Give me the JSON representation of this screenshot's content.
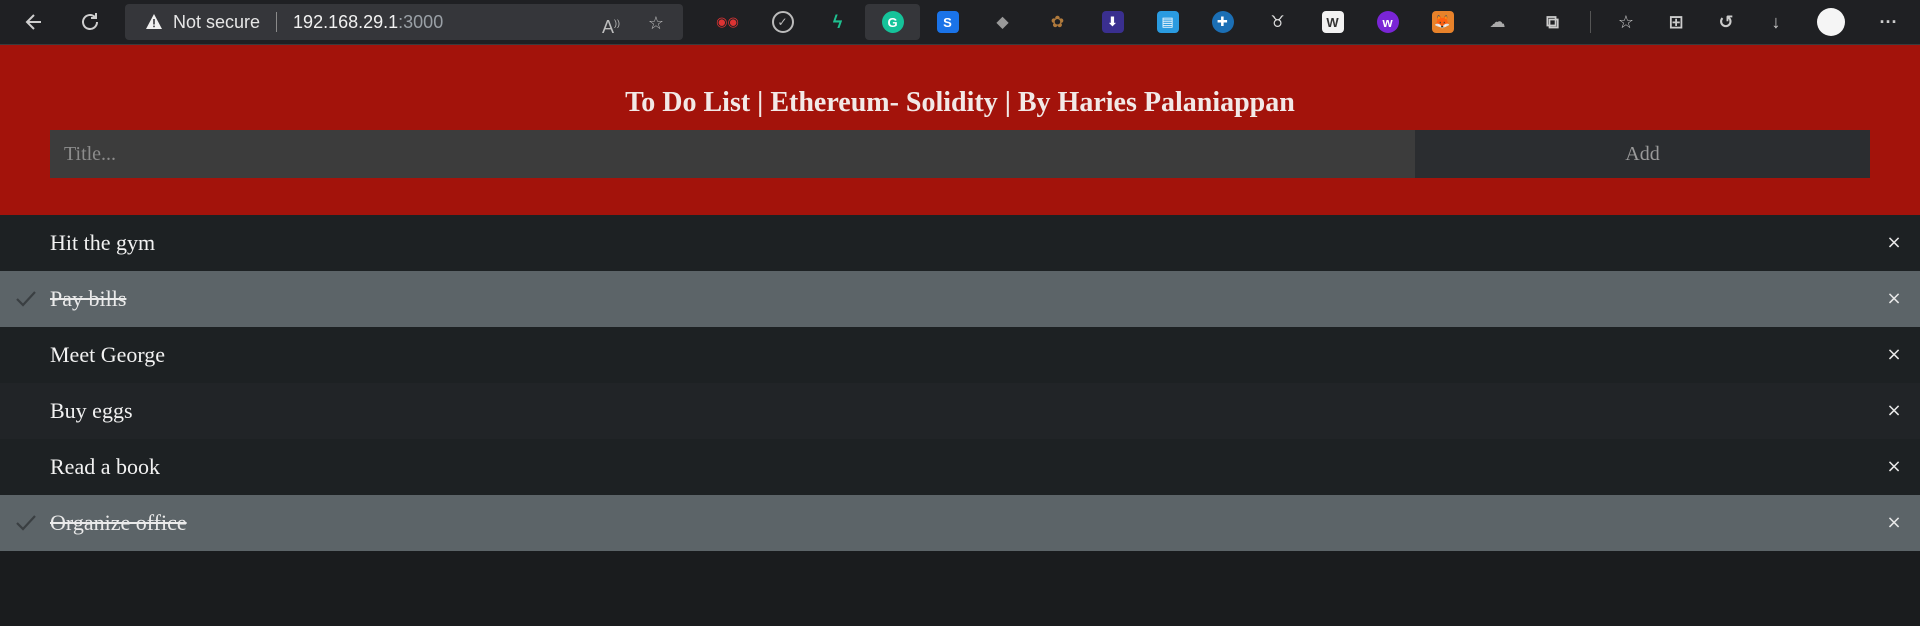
{
  "browser": {
    "security_label": "Not secure",
    "url_host": "192.168.29.1",
    "url_port": ":3000",
    "extensions": [
      "glasses-icon",
      "check-circle-icon",
      "seahorse-icon",
      "grammarly-icon",
      "s-icon",
      "fish-icon",
      "puzzle-face-icon",
      "download-icon",
      "book-icon",
      "medical-icon",
      "bird-icon",
      "w-icon",
      "w-purple-icon",
      "fox-icon",
      "cloud-icon",
      "extensions-icon"
    ]
  },
  "app": {
    "title": "To Do List | Ethereum- Solidity | By Haries Palaniappan",
    "input_placeholder": "Title...",
    "add_label": "Add"
  },
  "todos": [
    {
      "text": "Hit the gym",
      "checked": false
    },
    {
      "text": "Pay bills",
      "checked": true
    },
    {
      "text": "Meet George",
      "checked": false
    },
    {
      "text": "Buy eggs",
      "checked": false
    },
    {
      "text": "Read a book",
      "checked": false
    },
    {
      "text": "Organize office",
      "checked": true
    }
  ],
  "colors": {
    "header_bg": "#a3130b",
    "row_odd": "#1d2123",
    "row_even": "#212427",
    "row_checked": "#5c6468"
  },
  "close_symbol": "×"
}
